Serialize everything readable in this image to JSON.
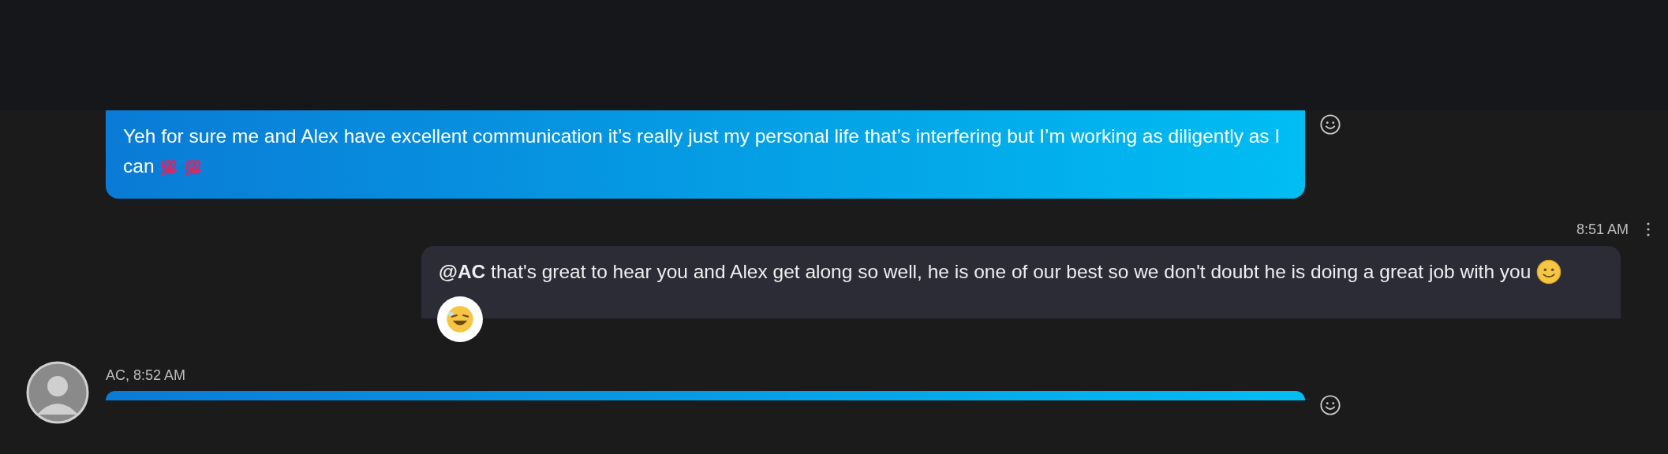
{
  "messages": [
    {
      "kind": "incoming",
      "text": "Yeh for sure me and Alex have excellent communication it’s really just my personal life that’s interfering but I’m working as diligently as I can",
      "emojis": [
        {
          "kind": "hundred"
        },
        {
          "kind": "hundred"
        }
      ]
    },
    {
      "kind": "outgoing",
      "time": "8:51 AM",
      "text": "**@AC** that's great to hear you and Alex get along so well, he is one of our best so we don't doubt he is doing a great job with you",
      "emojis": [
        {
          "kind": "smile"
        }
      ],
      "reaction": {
        "kind": "laugh"
      }
    },
    {
      "kind": "incoming",
      "sender": "AC, 8:52 AM",
      "avatar": true
    }
  ]
}
